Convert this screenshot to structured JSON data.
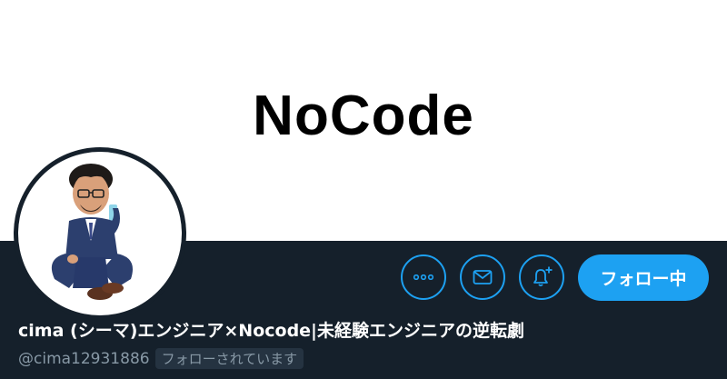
{
  "banner": {
    "text": "NoCode"
  },
  "profile": {
    "display_name": "cima (シーマ)エンジニア×Nocode|未経験エンジニアの逆転劇",
    "handle": "@cima12931886",
    "follows_you_badge": "フォローされています"
  },
  "actions": {
    "more_icon": "more-dots-icon",
    "message_icon": "envelope-icon",
    "notify_icon": "bell-plus-icon",
    "follow_label": "フォロー中"
  },
  "colors": {
    "accent": "#1da1f2",
    "background": "#15202b",
    "secondary_text": "#8899a6"
  }
}
